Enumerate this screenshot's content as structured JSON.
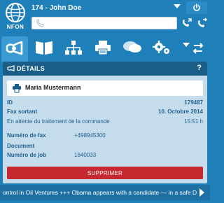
{
  "brand": {
    "logo_text": "NFON"
  },
  "header": {
    "user_label": "174 - John Doe",
    "dial_input": {
      "value": "",
      "placeholder": ""
    }
  },
  "tabs": [
    {
      "name": "fax-tab",
      "icon": "horn-icon",
      "active": true
    },
    {
      "name": "phonebook-tab",
      "icon": "book-icon",
      "active": false
    },
    {
      "name": "org-tab",
      "icon": "org-chart-icon",
      "active": false
    },
    {
      "name": "print-tab",
      "icon": "printer-icon",
      "active": false
    },
    {
      "name": "chat-tab",
      "icon": "chat-icon",
      "active": false
    },
    {
      "name": "settings-tab",
      "icon": "gears-icon",
      "active": false
    },
    {
      "name": "transfer-tab",
      "icon": "transfer-icon",
      "active": false
    }
  ],
  "panel": {
    "title": "DÉTAILS",
    "help": "?",
    "contact_name": "Maria Mustermann",
    "id_label": "ID",
    "id_value": "179487",
    "fax_label": "Fax sortant",
    "fax_date": "10. Octobre 2014",
    "status_text": "En attente du traitement de la commande",
    "status_time": "15:51 h",
    "fax_number_label": "Numéro de fax",
    "fax_number_value": "+498945300",
    "document_label": "Document",
    "document_value": "",
    "job_label": "Numéro de job",
    "job_value": "1840033",
    "delete_label": "SUPPRIMER"
  },
  "ticker": {
    "text": "ontrol in Oil Ventures    +++    Obama appears with a candidate — in a safe D"
  },
  "colors": {
    "background": "#1f7fb9",
    "panel_header": "#1a5d87",
    "panel_body": "#c4dceb",
    "delete": "#c7272e"
  }
}
